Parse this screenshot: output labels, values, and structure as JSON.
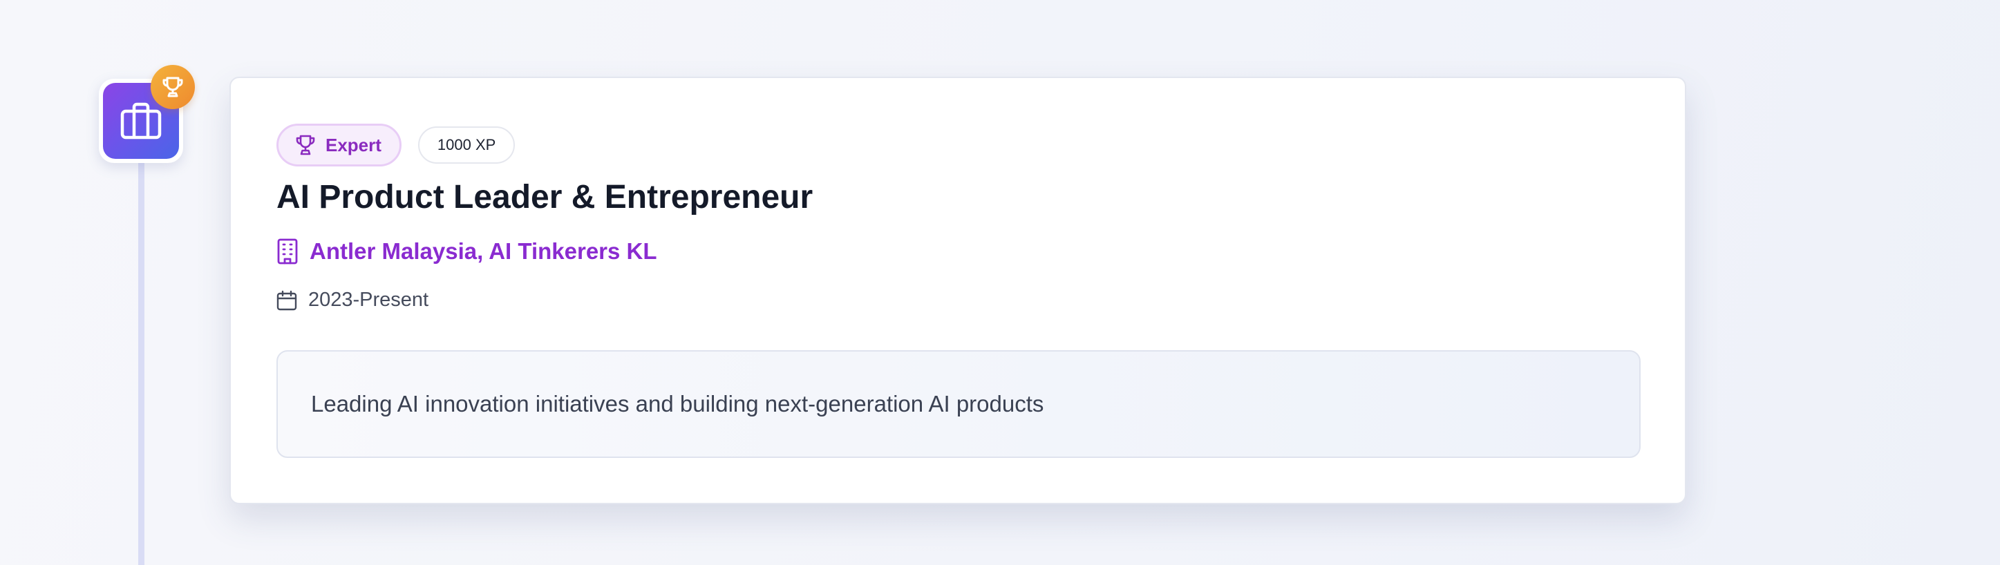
{
  "timeline": {
    "node_icon": "briefcase-icon",
    "badge_icon": "trophy-icon",
    "colors": {
      "node_gradient": [
        "#8b45e6",
        "#4a65e8"
      ],
      "badge_gradient": [
        "#f4b23c",
        "#ee8a2e"
      ],
      "line": "#d9dcf5"
    }
  },
  "card": {
    "level_tag": {
      "icon": "trophy-icon",
      "label": "Expert"
    },
    "xp_tag": {
      "label": "1000 XP"
    },
    "title": "AI Product Leader & Entrepreneur",
    "company": {
      "icon": "building-icon",
      "label": "Antler Malaysia, AI Tinkerers KL"
    },
    "dates": {
      "icon": "calendar-icon",
      "label": "2023-Present"
    },
    "description": "Leading AI innovation initiatives and building next-generation AI products",
    "colors": {
      "accent": "#8a2bd0",
      "title": "#141a29",
      "text": "#3a4152"
    }
  }
}
